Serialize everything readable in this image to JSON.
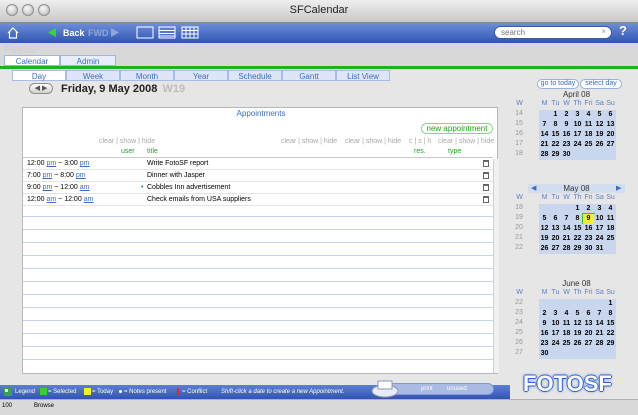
{
  "window": {
    "title": "SFCalendar"
  },
  "toolbar": {
    "back": "Back",
    "forward": "FWD",
    "search_placeholder": "search",
    "help": "?"
  },
  "brand": "FotoSF",
  "main_tabs": [
    "Calendar",
    "Admin"
  ],
  "sub_tabs": [
    "Day",
    "Week",
    "Month",
    "Year",
    "Schedule",
    "Gantt",
    "List View"
  ],
  "date_header": {
    "date": "Friday, 9 May 2008",
    "week": "W19"
  },
  "goto": {
    "today": "go to today",
    "select": "select day"
  },
  "appointments": {
    "title": "Appointments",
    "new_button": "new appointment",
    "controls": {
      "user": "clear | show | hide",
      "title": "clear | show | hide",
      "mid": "clear | show | hide",
      "res": "c | s | h",
      "type": "clear | show | hide"
    },
    "columns": {
      "user": "user",
      "title": "title",
      "res": "res.",
      "type": "type"
    },
    "rows": [
      {
        "start": "12:00",
        "start_ampm": "pm",
        "end": "3:00",
        "end_ampm": "pm",
        "title": "Write FotoSF report",
        "notes": false
      },
      {
        "start": "7:00",
        "start_ampm": "pm",
        "end": "8:00",
        "end_ampm": "pm",
        "title": "Dinner with Jasper",
        "notes": false
      },
      {
        "start": "9:00",
        "start_ampm": "pm",
        "end": "12:00",
        "end_ampm": "am",
        "title": "Cobbles Inn advertisement",
        "notes": true
      },
      {
        "start": "12:00",
        "start_ampm": "am",
        "end": "12:00",
        "end_ampm": "am",
        "title": "Check emails from USA suppliers",
        "notes": false
      }
    ]
  },
  "mini_calendars": [
    {
      "title": "April 08",
      "headers": [
        "W",
        "M",
        "Tu",
        "W",
        "Th",
        "Fri",
        "Sa",
        "Su"
      ],
      "weeks": [
        {
          "wk": "14",
          "days": [
            "",
            "1",
            "2",
            "3",
            "4",
            "5",
            "6"
          ]
        },
        {
          "wk": "15",
          "days": [
            "7",
            "8",
            "9",
            "10",
            "11",
            "12",
            "13"
          ]
        },
        {
          "wk": "16",
          "days": [
            "14",
            "15",
            "16",
            "17",
            "18",
            "19",
            "20"
          ]
        },
        {
          "wk": "17",
          "days": [
            "21",
            "22",
            "23",
            "24",
            "25",
            "26",
            "27"
          ]
        },
        {
          "wk": "18",
          "days": [
            "28",
            "29",
            "30",
            "",
            "",
            "",
            ""
          ]
        }
      ]
    },
    {
      "title": "May 08",
      "headers": [
        "W",
        "M",
        "Tu",
        "W",
        "Th",
        "Fri",
        "Sa",
        "Su"
      ],
      "weeks": [
        {
          "wk": "18",
          "days": [
            "",
            "",
            "",
            "1",
            "2",
            "3",
            "4"
          ]
        },
        {
          "wk": "19",
          "days": [
            "5",
            "6",
            "7",
            "8",
            "9",
            "10",
            "11"
          ]
        },
        {
          "wk": "20",
          "days": [
            "12",
            "13",
            "14",
            "15",
            "16",
            "17",
            "18"
          ]
        },
        {
          "wk": "21",
          "days": [
            "19",
            "20",
            "21",
            "22",
            "23",
            "24",
            "25"
          ]
        },
        {
          "wk": "22",
          "days": [
            "26",
            "27",
            "28",
            "29",
            "30",
            "31",
            ""
          ]
        }
      ],
      "today": "9"
    },
    {
      "title": "June 08",
      "headers": [
        "W",
        "M",
        "Tu",
        "W",
        "Th",
        "Fri",
        "Sa",
        "Su"
      ],
      "weeks": [
        {
          "wk": "22",
          "days": [
            "",
            "",
            "",
            "",
            "",
            "",
            "1"
          ]
        },
        {
          "wk": "23",
          "days": [
            "2",
            "3",
            "4",
            "5",
            "6",
            "7",
            "8"
          ]
        },
        {
          "wk": "24",
          "days": [
            "9",
            "10",
            "11",
            "12",
            "13",
            "14",
            "15"
          ]
        },
        {
          "wk": "25",
          "days": [
            "16",
            "17",
            "18",
            "19",
            "20",
            "21",
            "22"
          ]
        },
        {
          "wk": "26",
          "days": [
            "23",
            "24",
            "25",
            "26",
            "27",
            "28",
            "29"
          ]
        },
        {
          "wk": "27",
          "days": [
            "30",
            "",
            "",
            "",
            "",
            "",
            ""
          ]
        }
      ]
    }
  ],
  "legend": {
    "label": "Legend",
    "selected": "= Selected",
    "today": "= Today",
    "notes": "= Notes present",
    "conflict": "= Conflict",
    "hint": "Shift-click a date to create a new Appointment."
  },
  "print": {
    "print": "print",
    "unused": "unused"
  },
  "logo": "FOTOSF",
  "status": {
    "zoom": "100",
    "mode": "Browse"
  },
  "colors": {
    "accent": "#3b6cc7",
    "green": "#17b521",
    "today": "#f4f02a"
  }
}
